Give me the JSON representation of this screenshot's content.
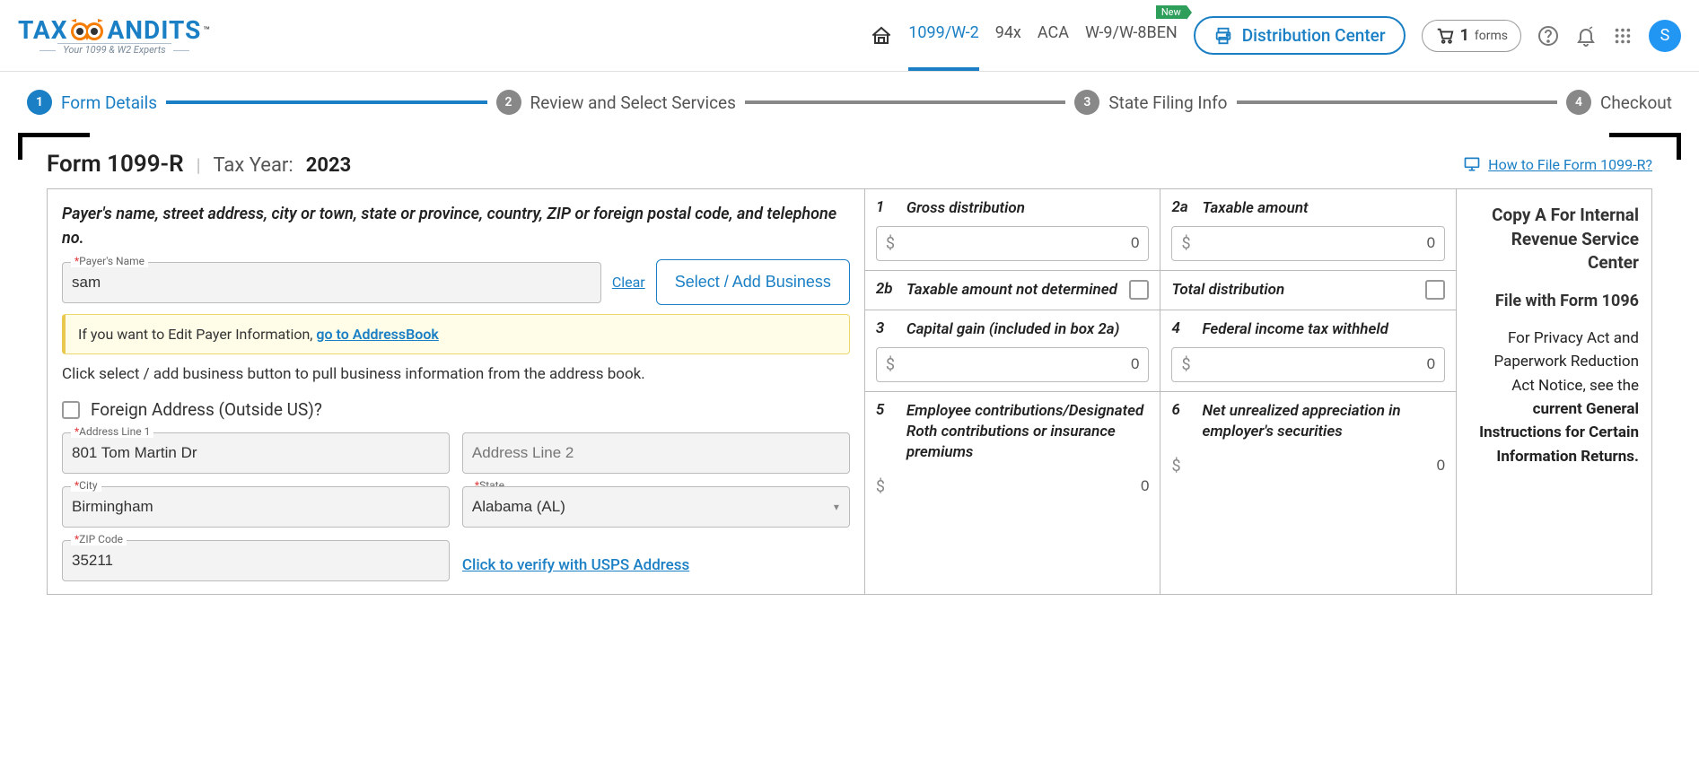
{
  "brand": {
    "name": "TAXBANDITS",
    "tagline": "Your 1099 & W2 Experts",
    "tm": "™"
  },
  "nav": {
    "items": [
      "1099/W-2",
      "94x",
      "ACA",
      "W-9/W-8BEN"
    ],
    "activeIndex": 0,
    "badge": "New",
    "distribution": "Distribution Center",
    "cart": {
      "count": "1",
      "label": "forms"
    },
    "avatar": "S"
  },
  "steps": [
    {
      "num": "1",
      "label": "Form Details"
    },
    {
      "num": "2",
      "label": "Review and Select Services"
    },
    {
      "num": "3",
      "label": "State Filing Info"
    },
    {
      "num": "4",
      "label": "Checkout"
    }
  ],
  "form": {
    "title": "Form 1099-R",
    "taxYearLabel": "Tax Year:",
    "taxYear": "2023",
    "helpLink": "How to File Form 1099-R?"
  },
  "payer": {
    "heading": "Payer's name, street address, city or town, state or province, country, ZIP or foreign postal code, and telephone no.",
    "nameLabel": "Payer's Name",
    "name": "sam",
    "clear": "Clear",
    "selectBtn": "Select / Add Business",
    "infoBanner": {
      "prefix": "If you want to Edit Payer Information, ",
      "link": "go to AddressBook"
    },
    "hint": "Click select / add business button to pull business information from the address book.",
    "foreignLabel": "Foreign Address (Outside US)?",
    "addr1Label": "Address Line 1",
    "addr1": "801 Tom Martin Dr",
    "addr2Placeholder": "Address Line 2",
    "cityLabel": "City",
    "city": "Birmingham",
    "stateLabel": "State",
    "state": "Alabama (AL)",
    "zipLabel": "ZIP Code",
    "zip": "35211",
    "verifyLink": "Click to verify with USPS Address"
  },
  "boxes": {
    "b1": {
      "num": "1",
      "label": "Gross distribution",
      "val": "0"
    },
    "b2a": {
      "num": "2a",
      "label": "Taxable amount",
      "val": "0"
    },
    "b2b": {
      "num": "2b",
      "label": "Taxable amount not determined"
    },
    "btotal": {
      "label": "Total distribution"
    },
    "b3": {
      "num": "3",
      "label": "Capital gain (included in box 2a)",
      "val": "0"
    },
    "b4": {
      "num": "4",
      "label": "Federal income tax withheld",
      "val": "0"
    },
    "b5": {
      "num": "5",
      "label": "Employee contributions/Designated Roth contributions or insurance premiums",
      "val": "0"
    },
    "b6": {
      "num": "6",
      "label": "Net unrealized appreciation in employer's securities",
      "val": "0"
    }
  },
  "copy": {
    "title": "Copy A For Internal Revenue Service Center",
    "sub": "File with Form 1096",
    "text1": "For Privacy Act and Paperwork Reduction Act Notice, see the ",
    "bold": "current General Instructions for Certain Information Returns."
  }
}
